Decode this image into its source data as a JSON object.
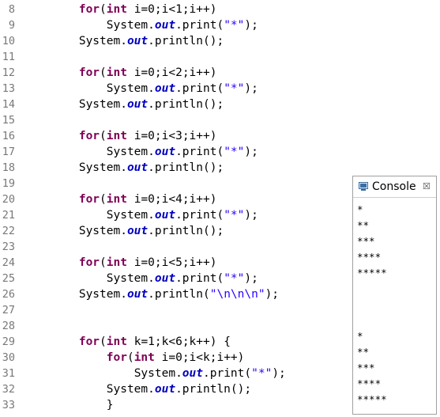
{
  "editor": {
    "lines": [
      {
        "n": "8",
        "i": "        ",
        "t": [
          [
            "kw",
            "for"
          ],
          [
            "",
            "("
          ],
          [
            "kw",
            "int"
          ],
          [
            "",
            " i=0;i<1;i++)"
          ]
        ]
      },
      {
        "n": "9",
        "i": "            ",
        "t": [
          [
            "",
            "System."
          ],
          [
            "fld",
            "out"
          ],
          [
            "",
            ".print("
          ],
          [
            "str",
            "\"*\""
          ],
          [
            "",
            ");"
          ]
        ]
      },
      {
        "n": "10",
        "i": "        ",
        "t": [
          [
            "",
            "System."
          ],
          [
            "fld",
            "out"
          ],
          [
            "",
            ".println();"
          ]
        ]
      },
      {
        "n": "11",
        "i": "",
        "t": []
      },
      {
        "n": "12",
        "i": "        ",
        "t": [
          [
            "kw",
            "for"
          ],
          [
            "",
            "("
          ],
          [
            "kw",
            "int"
          ],
          [
            "",
            " i=0;i<2;i++)"
          ]
        ]
      },
      {
        "n": "13",
        "i": "            ",
        "t": [
          [
            "",
            "System."
          ],
          [
            "fld",
            "out"
          ],
          [
            "",
            ".print("
          ],
          [
            "str",
            "\"*\""
          ],
          [
            "",
            ");"
          ]
        ]
      },
      {
        "n": "14",
        "i": "        ",
        "t": [
          [
            "",
            "System."
          ],
          [
            "fld",
            "out"
          ],
          [
            "",
            ".println();"
          ]
        ]
      },
      {
        "n": "15",
        "i": "",
        "t": []
      },
      {
        "n": "16",
        "i": "        ",
        "t": [
          [
            "kw",
            "for"
          ],
          [
            "",
            "("
          ],
          [
            "kw",
            "int"
          ],
          [
            "",
            " i=0;i<3;i++)"
          ]
        ]
      },
      {
        "n": "17",
        "i": "            ",
        "t": [
          [
            "",
            "System."
          ],
          [
            "fld",
            "out"
          ],
          [
            "",
            ".print("
          ],
          [
            "str",
            "\"*\""
          ],
          [
            "",
            ");"
          ]
        ]
      },
      {
        "n": "18",
        "i": "        ",
        "t": [
          [
            "",
            "System."
          ],
          [
            "fld",
            "out"
          ],
          [
            "",
            ".println();"
          ]
        ]
      },
      {
        "n": "19",
        "i": "",
        "t": []
      },
      {
        "n": "20",
        "i": "        ",
        "t": [
          [
            "kw",
            "for"
          ],
          [
            "",
            "("
          ],
          [
            "kw",
            "int"
          ],
          [
            "",
            " i=0;i<4;i++)"
          ]
        ]
      },
      {
        "n": "21",
        "i": "            ",
        "t": [
          [
            "",
            "System."
          ],
          [
            "fld",
            "out"
          ],
          [
            "",
            ".print("
          ],
          [
            "str",
            "\"*\""
          ],
          [
            "",
            ");"
          ]
        ]
      },
      {
        "n": "22",
        "i": "        ",
        "t": [
          [
            "",
            "System."
          ],
          [
            "fld",
            "out"
          ],
          [
            "",
            ".println();"
          ]
        ]
      },
      {
        "n": "23",
        "i": "",
        "t": []
      },
      {
        "n": "24",
        "i": "        ",
        "t": [
          [
            "kw",
            "for"
          ],
          [
            "",
            "("
          ],
          [
            "kw",
            "int"
          ],
          [
            "",
            " i=0;i<5;i++)"
          ]
        ]
      },
      {
        "n": "25",
        "i": "            ",
        "t": [
          [
            "",
            "System."
          ],
          [
            "fld",
            "out"
          ],
          [
            "",
            ".print("
          ],
          [
            "str",
            "\"*\""
          ],
          [
            "",
            ");"
          ]
        ]
      },
      {
        "n": "26",
        "i": "        ",
        "t": [
          [
            "",
            "System."
          ],
          [
            "fld",
            "out"
          ],
          [
            "",
            ".println("
          ],
          [
            "str",
            "\"\\n\\n\\n\""
          ],
          [
            "",
            ");"
          ]
        ]
      },
      {
        "n": "27",
        "i": "",
        "t": []
      },
      {
        "n": "28",
        "i": "",
        "t": []
      },
      {
        "n": "29",
        "i": "        ",
        "t": [
          [
            "kw",
            "for"
          ],
          [
            "",
            "("
          ],
          [
            "kw",
            "int"
          ],
          [
            "",
            " k=1;k<6;k++) {"
          ]
        ]
      },
      {
        "n": "30",
        "i": "            ",
        "t": [
          [
            "kw",
            "for"
          ],
          [
            "",
            "("
          ],
          [
            "kw",
            "int"
          ],
          [
            "",
            " i=0;i<k;i++)"
          ]
        ]
      },
      {
        "n": "31",
        "i": "                ",
        "t": [
          [
            "",
            "System."
          ],
          [
            "fld",
            "out"
          ],
          [
            "",
            ".print("
          ],
          [
            "str",
            "\"*\""
          ],
          [
            "",
            ");"
          ]
        ]
      },
      {
        "n": "32",
        "i": "            ",
        "t": [
          [
            "",
            "System."
          ],
          [
            "fld",
            "out"
          ],
          [
            "",
            ".println();"
          ]
        ]
      },
      {
        "n": "33",
        "i": "            ",
        "t": [
          [
            "",
            "}"
          ]
        ]
      }
    ]
  },
  "console": {
    "title": "Console",
    "close_glyph": "☒",
    "icon": "console-view-icon",
    "output": [
      "*",
      "**",
      "***",
      "****",
      "*****",
      "",
      "",
      "",
      "*",
      "**",
      "***",
      "****",
      "*****"
    ]
  },
  "colors": {
    "keyword": "#7f0055",
    "field": "#0000c0",
    "string": "#2a00ff",
    "line_number": "#787878"
  }
}
